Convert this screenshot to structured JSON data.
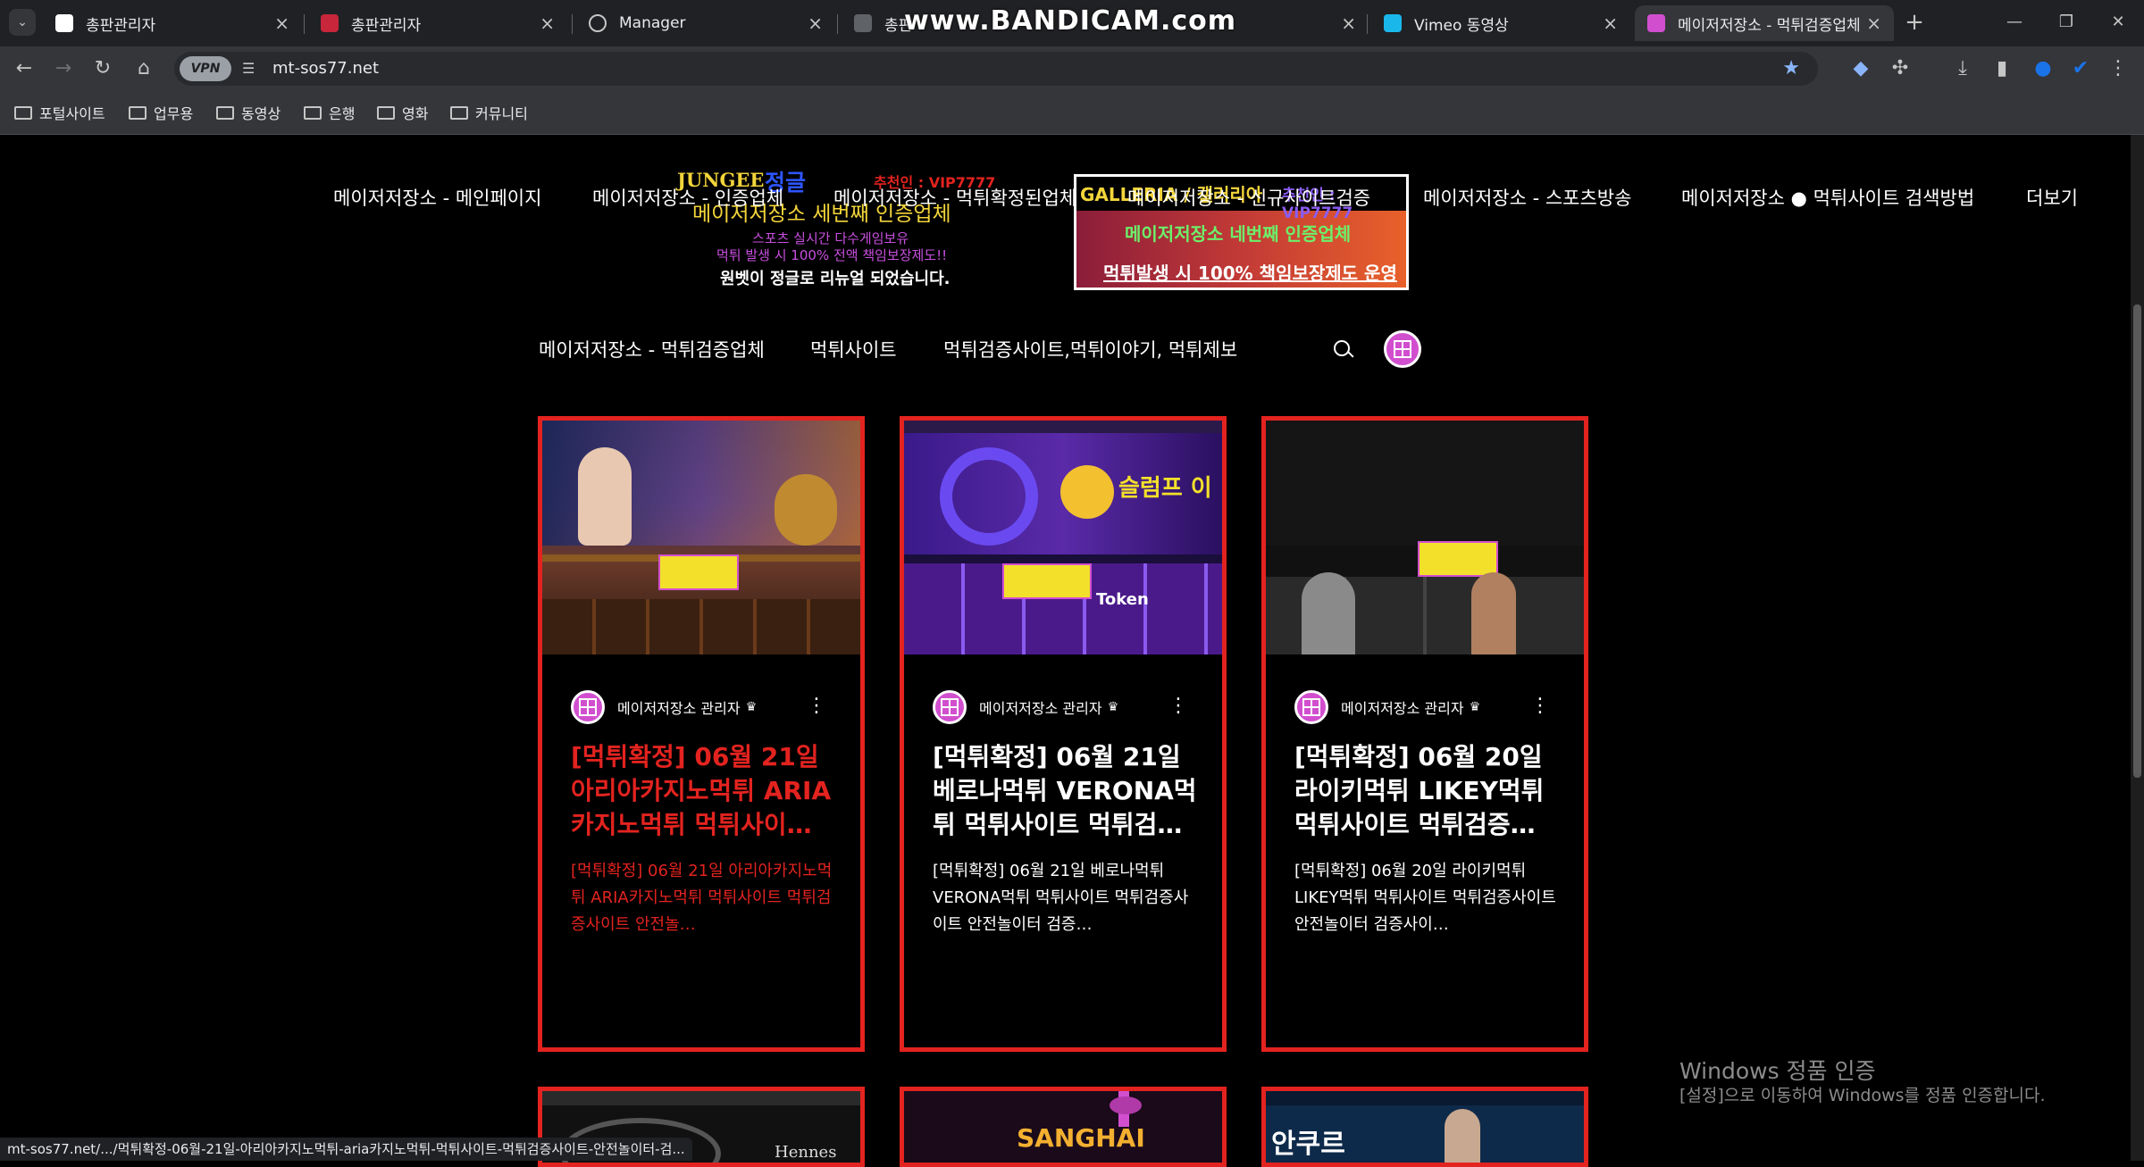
{
  "browser": {
    "tabs": [
      {
        "label": "총판관리자",
        "fav_color": "#ffffff"
      },
      {
        "label": "총판관리자",
        "fav_color": "#c7263b"
      },
      {
        "label": "Manager",
        "fav_color": "#5f6368"
      },
      {
        "label": "총판",
        "fav_color": "#5f6368"
      },
      {
        "label": "",
        "fav_color": "#202124"
      },
      {
        "label": "Vimeo 동영상",
        "fav_color": "#1ab7ea"
      },
      {
        "label": "메이저저장소 - 먹튀검증업체,",
        "fav_color": "#d14fcf"
      }
    ],
    "overlay_watermark": "www.BANDICAM.com",
    "url": "mt-sos77.net",
    "vpn_label": "VPN",
    "new_tab": "+",
    "window_controls": {
      "minimize": "—",
      "restore": "❐",
      "close": "✕"
    },
    "bookmarks": [
      "포털사이트",
      "업무용",
      "동영상",
      "은행",
      "영화",
      "커뮤니티"
    ],
    "status_url": "mt-sos77.net/.../먹튀확정-06월-21일-아리아카지노먹튀-aria카지노먹튀-먹튀사이트-먹튀검증사이트-안전놀이터-검..."
  },
  "site": {
    "main_menu": [
      "메이저저장소 - 메인페이지",
      "메이저저장소 - 인증업체",
      "메이저저장소 - 먹튀확정된업체",
      "메이저저장소 - 신규사이트검증",
      "메이저저장소 - 스포츠방송",
      "메이저저장소 ● 먹튀사이트 검색방법",
      "더보기"
    ],
    "ad_left": {
      "brand": "JUNGEE",
      "brand2": "정글",
      "referral": "추천인 : VIP7777",
      "line1": "메이저저장소 세번째 인증업체",
      "line2": "스포츠 실시간 다수게임보유",
      "line3": "먹튀 발생 시 100% 전액 책임보장제도!!",
      "line4": "원벳이 정글로 리뉴얼 되었습니다."
    },
    "ad_right": {
      "brand": "GALLERIA / 갤러리아",
      "referral": "추천인 : VIP7777",
      "line1": "메이저저장소 네번째 인증업체",
      "line2": "먹튀발생 시 100% 책임보장제도 운영"
    },
    "sub_menu": [
      "메이저저장소 - 먹튀검증업체",
      "먹튀사이트",
      "먹튀검증사이트,먹튀이야기, 먹튀제보"
    ],
    "cards": [
      {
        "author": "메이저저장소 관리자",
        "title": "[먹튀확정] 06월 21일 아리아카지노먹튀 ARIA카지노먹튀 먹튀사이…",
        "excerpt": "[먹튀확정] 06월 21일 아리아카지노먹튀 ARIA카지노먹튀 먹튀사이트 먹튀검증사이트 안전놀…",
        "hovered": true
      },
      {
        "author": "메이저저장소 관리자",
        "title": "[먹튀확정] 06월 21일 베로나먹튀 VERONA먹튀 먹튀사이트 먹튀검…",
        "excerpt": "[먹튀확정] 06월 21일 베로나먹튀 VERONA먹튀 먹튀사이트 먹튀검증사이트 안전놀이터 검증…",
        "hovered": false
      },
      {
        "author": "메이저저장소 관리자",
        "title": "[먹튀확정] 06월 20일 라이키먹튀 LIKEY먹튀 먹튀사이트 먹튀검증…",
        "excerpt": "[먹튀확정] 06월 20일 라이키먹튀 LIKEY먹튀 먹튀사이트 먹튀검증사이트 안전놀이터 검증사이…",
        "hovered": false
      }
    ],
    "thumb_texts": {
      "card2_banner": "슬럼프 이",
      "card2_token": "Token",
      "next_row_2": "SANGHAI",
      "next_row_3": "안쿠르",
      "next_row_1": "Hennes"
    }
  },
  "windows_watermark": {
    "line1": "Windows 정품 인증",
    "line2": "[설정]으로 이동하여 Windows를 정품 인증합니다."
  },
  "colors": {
    "accent_red": "#e3231f",
    "hover_text": "#e3231f",
    "brand_pink": "#d14fcf"
  }
}
